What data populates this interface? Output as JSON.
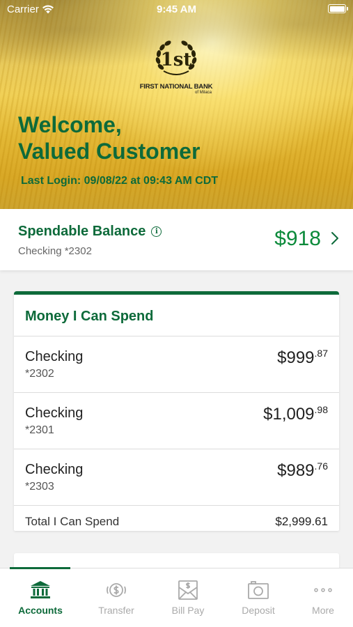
{
  "status_bar": {
    "carrier": "Carrier",
    "time": "9:45 AM"
  },
  "logo": {
    "mark": "1st",
    "name": "FIRST NATIONAL BANK",
    "sub": "of Milaca"
  },
  "welcome": {
    "line1": "Welcome,",
    "line2": "Valued Customer",
    "last_login": "Last Login: 09/08/22 at 09:43 AM CDT"
  },
  "spendable": {
    "title": "Spendable Balance",
    "info_icon": "i",
    "account": "Checking *2302",
    "amount": "$918"
  },
  "money_card": {
    "title": "Money I Can Spend",
    "accounts": [
      {
        "name": "Checking",
        "number": "*2302",
        "dollars": "$999",
        "cents": ".87"
      },
      {
        "name": "Checking",
        "number": "*2301",
        "dollars": "$1,009",
        "cents": ".98"
      },
      {
        "name": "Checking",
        "number": "*2303",
        "dollars": "$989",
        "cents": ".76"
      }
    ],
    "total_label": "Total I Can Spend",
    "total_value": "$2,999.61"
  },
  "tabs": [
    {
      "label": "Accounts",
      "icon": "bank-icon",
      "active": true
    },
    {
      "label": "Transfer",
      "icon": "transfer-icon",
      "active": false
    },
    {
      "label": "Bill Pay",
      "icon": "bill-pay-icon",
      "active": false
    },
    {
      "label": "Deposit",
      "icon": "camera-icon",
      "active": false
    },
    {
      "label": "More",
      "icon": "more-icon",
      "active": false
    }
  ],
  "colors": {
    "brand_green": "#0d6a3a",
    "amount_green": "#0b8a3a",
    "inactive_tab": "#aaaaaa"
  }
}
